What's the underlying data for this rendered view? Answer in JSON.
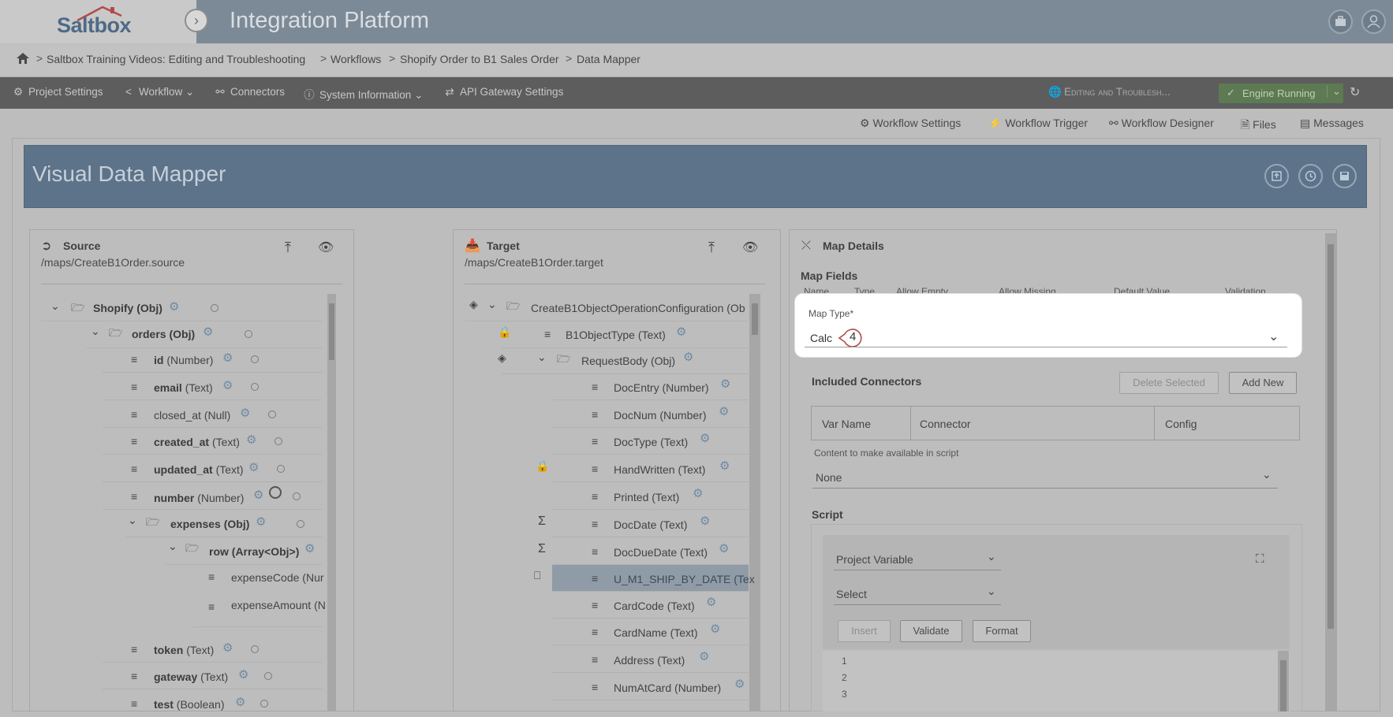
{
  "app": {
    "logo_text": "Saltbox",
    "title": "Integration Platform"
  },
  "breadcrumb": [
    "Saltbox Training Videos: Editing and Troubleshooting",
    "Workflows",
    "Shopify Order to B1 Sales Order",
    "Data Mapper"
  ],
  "menu": {
    "project_settings": "Project Settings",
    "workflow": "Workflow",
    "connectors": "Connectors",
    "system_information": "System Information",
    "api_gateway": "API Gateway Settings",
    "environment": "Editing and Troublesh...",
    "engine_status": "Engine Running"
  },
  "subnav": {
    "workflow_settings": "Workflow Settings",
    "workflow_trigger": "Workflow Trigger",
    "workflow_designer": "Workflow Designer",
    "files": "Files",
    "messages": "Messages"
  },
  "page_title": "Visual Data Mapper",
  "source": {
    "title": "Source",
    "path": "/maps/CreateB1Order.source",
    "rows": [
      {
        "name": "Shopify",
        "type": "(Obj)"
      },
      {
        "name": "orders",
        "type": "(Obj)"
      },
      {
        "name": "id",
        "type": "(Number)"
      },
      {
        "name": "email",
        "type": "(Text)"
      },
      {
        "name": "closed_at",
        "type": "(Null)"
      },
      {
        "name": "created_at",
        "type": "(Text)"
      },
      {
        "name": "updated_at",
        "type": "(Text)"
      },
      {
        "name": "number",
        "type": "(Number)"
      },
      {
        "name": "expenses",
        "type": "(Obj)"
      },
      {
        "name": "row",
        "type": "(Array<Obj>)"
      },
      {
        "name": "expenseCode",
        "type": "(Nur"
      },
      {
        "name": "expenseAmount",
        "type": "(N"
      },
      {
        "name": "token",
        "type": "(Text)"
      },
      {
        "name": "gateway",
        "type": "(Text)"
      },
      {
        "name": "test",
        "type": "(Boolean)"
      }
    ]
  },
  "target": {
    "title": "Target",
    "path": "/maps/CreateB1Order.target",
    "rows": [
      {
        "name": "CreateB1ObjectOperationConfiguration",
        "type": "(Ob"
      },
      {
        "name": "B1ObjectType",
        "type": "(Text)"
      },
      {
        "name": "RequestBody",
        "type": "(Obj)"
      },
      {
        "name": "DocEntry",
        "type": "(Number)"
      },
      {
        "name": "DocNum",
        "type": "(Number)"
      },
      {
        "name": "DocType",
        "type": "(Text)"
      },
      {
        "name": "HandWritten",
        "type": "(Text)"
      },
      {
        "name": "Printed",
        "type": "(Text)"
      },
      {
        "name": "DocDate",
        "type": "(Text)"
      },
      {
        "name": "DocDueDate",
        "type": "(Text)"
      },
      {
        "name": "U_M1_SHIP_BY_DATE",
        "type": "(Tex"
      },
      {
        "name": "CardCode",
        "type": "(Text)"
      },
      {
        "name": "CardName",
        "type": "(Text)"
      },
      {
        "name": "Address",
        "type": "(Text)"
      },
      {
        "name": "NumAtCard",
        "type": "(Number)"
      }
    ]
  },
  "details": {
    "title": "Map Details",
    "map_fields": "Map Fields",
    "columns": [
      "Name",
      "Type",
      "Allow Empty",
      "Allow Missing",
      "Default Value",
      "Validation"
    ],
    "map_type_label": "Map Type*",
    "map_type_value": "Calc",
    "step_marker": "4",
    "included_connectors": "Included Connectors",
    "delete_selected": "Delete Selected",
    "add_new": "Add New",
    "conn_cols": [
      "Var Name",
      "Connector",
      "Config"
    ],
    "content_label": "Content to make available in script",
    "content_value": "None",
    "script": "Script",
    "project_variable": "Project Variable",
    "select": "Select",
    "insert": "Insert",
    "validate": "Validate",
    "format": "Format",
    "line_numbers": [
      "1",
      "2",
      "3"
    ]
  }
}
